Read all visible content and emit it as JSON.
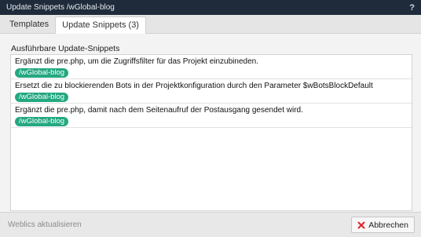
{
  "window": {
    "title": "Update Snippets /wGlobal-blog",
    "help_label": "?"
  },
  "tabs": [
    {
      "label": "Templates",
      "active": false
    },
    {
      "label": "Update Snippets (3)",
      "active": true
    }
  ],
  "main": {
    "section_label": "Ausführbare Update-Snippets",
    "items": [
      {
        "text": "Ergänzt die pre.php, um die Zugriffsfilter für das Projekt einzubineden.",
        "badge": "/wGlobal-blog"
      },
      {
        "text": "Ersetzt die zu blockierenden Bots in der Projektkonfiguration durch den Parameter $wBotsBlockDefault",
        "badge": "/wGlobal-blog"
      },
      {
        "text": "Ergänzt die pre.php, damit nach dem Seitenaufruf der Postausgang gesendet wird.",
        "badge": "/wGlobal-blog"
      }
    ]
  },
  "footer": {
    "update_link": "Weblics aktualisieren",
    "cancel_label": "Abbrechen"
  },
  "colors": {
    "titlebar": "#1f2b3b",
    "badge": "#24a880",
    "cancel_icon": "#e0262b"
  }
}
